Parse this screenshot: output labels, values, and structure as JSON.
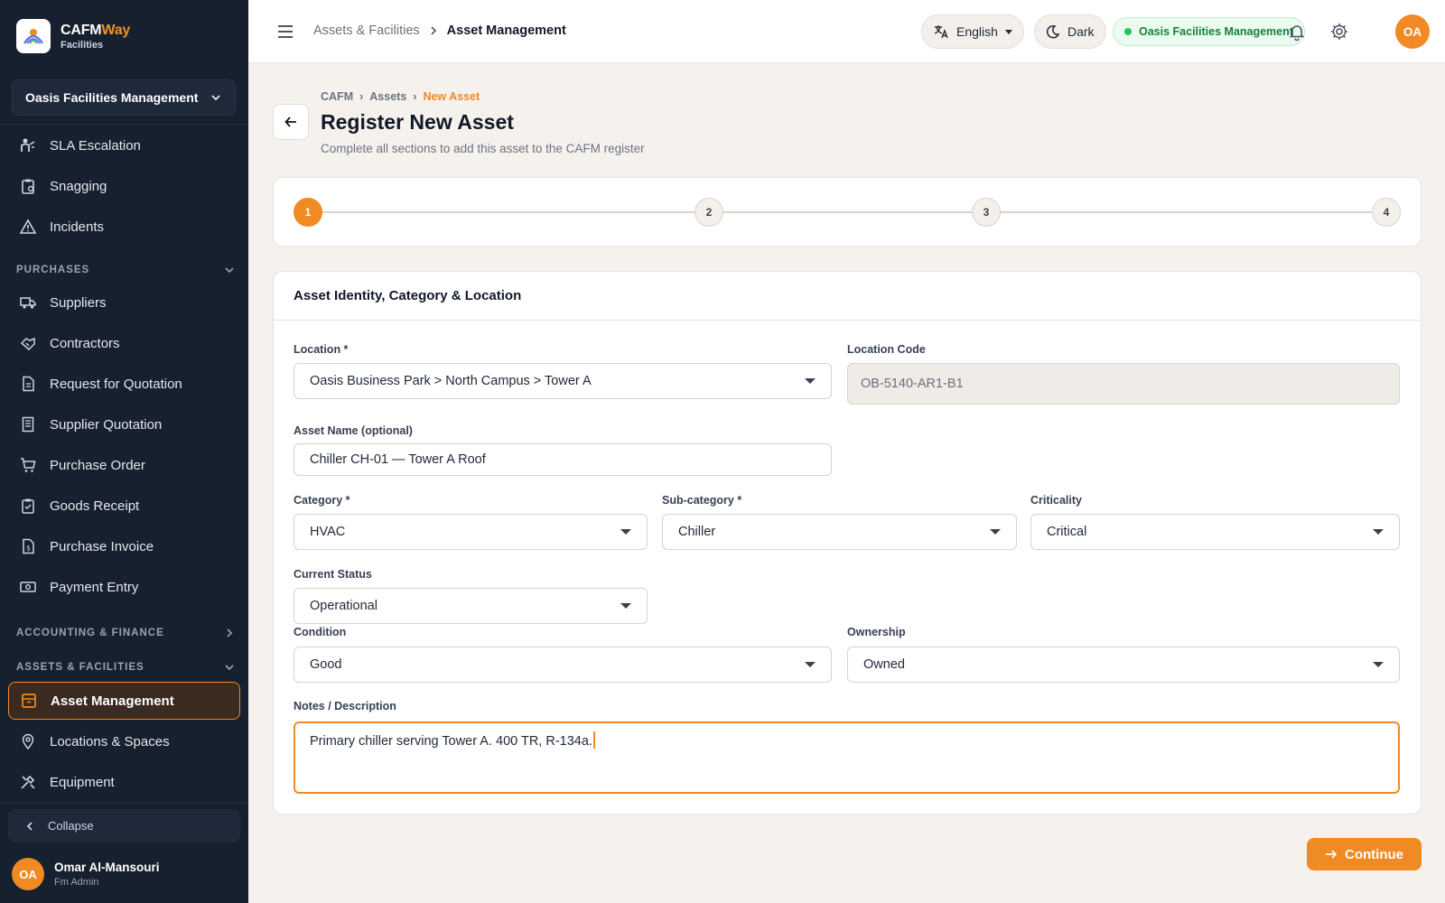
{
  "brand": {
    "name_main": "CAFM",
    "name_accent": "Way",
    "sub": "Facilities"
  },
  "sidebar": {
    "org": "Oasis Facilities Management",
    "items_top": [
      {
        "label": "SLA Escalation",
        "icon": "people-icon"
      },
      {
        "label": "Snagging",
        "icon": "clipboard-icon"
      },
      {
        "label": "Incidents",
        "icon": "warning-icon"
      }
    ],
    "purchases_title": "PURCHASES",
    "purchases": [
      {
        "label": "Suppliers",
        "icon": "truck-icon"
      },
      {
        "label": "Contractors",
        "icon": "handshake-icon"
      },
      {
        "label": "Request for Quotation",
        "icon": "document-icon"
      },
      {
        "label": "Supplier Quotation",
        "icon": "receipt-icon"
      },
      {
        "label": "Purchase Order",
        "icon": "cart-icon"
      },
      {
        "label": "Goods Receipt",
        "icon": "clipboard-check-icon"
      },
      {
        "label": "Purchase Invoice",
        "icon": "invoice-icon"
      },
      {
        "label": "Payment Entry",
        "icon": "cash-icon"
      }
    ],
    "accounting_title": "ACCOUNTING & FINANCE",
    "assets_title": "ASSETS & FACILITIES",
    "assets": [
      {
        "label": "Asset Management",
        "icon": "archive-icon",
        "active": true
      },
      {
        "label": "Locations & Spaces",
        "icon": "pin-icon"
      },
      {
        "label": "Equipment",
        "icon": "tools-icon"
      }
    ],
    "collapse": "Collapse",
    "user": {
      "initials": "OA",
      "name": "Omar Al-Mansouri",
      "role": "Fm Admin"
    }
  },
  "topbar": {
    "breadcrumb_parent": "Assets & Facilities",
    "breadcrumb_current": "Asset Management",
    "language": "English",
    "theme": "Dark",
    "org": "Oasis Facilities Management",
    "avatar": "OA"
  },
  "page": {
    "breadcrumb": [
      "CAFM",
      "Assets",
      "New Asset"
    ],
    "title": "Register New Asset",
    "subtitle": "Complete all sections to add this asset to the CAFM register"
  },
  "stepper": {
    "steps": [
      "1",
      "2",
      "3",
      "4"
    ],
    "current": 1
  },
  "form": {
    "section_title": "Asset Identity, Category & Location",
    "location_label": "Location *",
    "location_value": "Oasis Business Park > North Campus > Tower A",
    "location_code_label": "Location Code",
    "location_code_value": "OB-5140-AR1-B1",
    "asset_name_label": "Asset Name (optional)",
    "asset_name_value": "Chiller CH-01 — Tower A Roof",
    "category_label": "Category *",
    "category_value": "HVAC",
    "subcategory_label": "Sub-category *",
    "subcategory_value": "Chiller",
    "criticality_label": "Criticality",
    "criticality_value": "Critical",
    "status_label": "Current Status",
    "status_value": "Operational",
    "condition_label": "Condition",
    "condition_value": "Good",
    "ownership_label": "Ownership",
    "ownership_value": "Owned",
    "notes_label": "Notes / Description",
    "notes_value": "Primary chiller serving Tower A. 400 TR, R-134a."
  },
  "actions": {
    "continue": "Continue"
  },
  "colors": {
    "accent": "#f08a24",
    "sidebar_bg": "#16202e",
    "success": "#22c55e"
  }
}
